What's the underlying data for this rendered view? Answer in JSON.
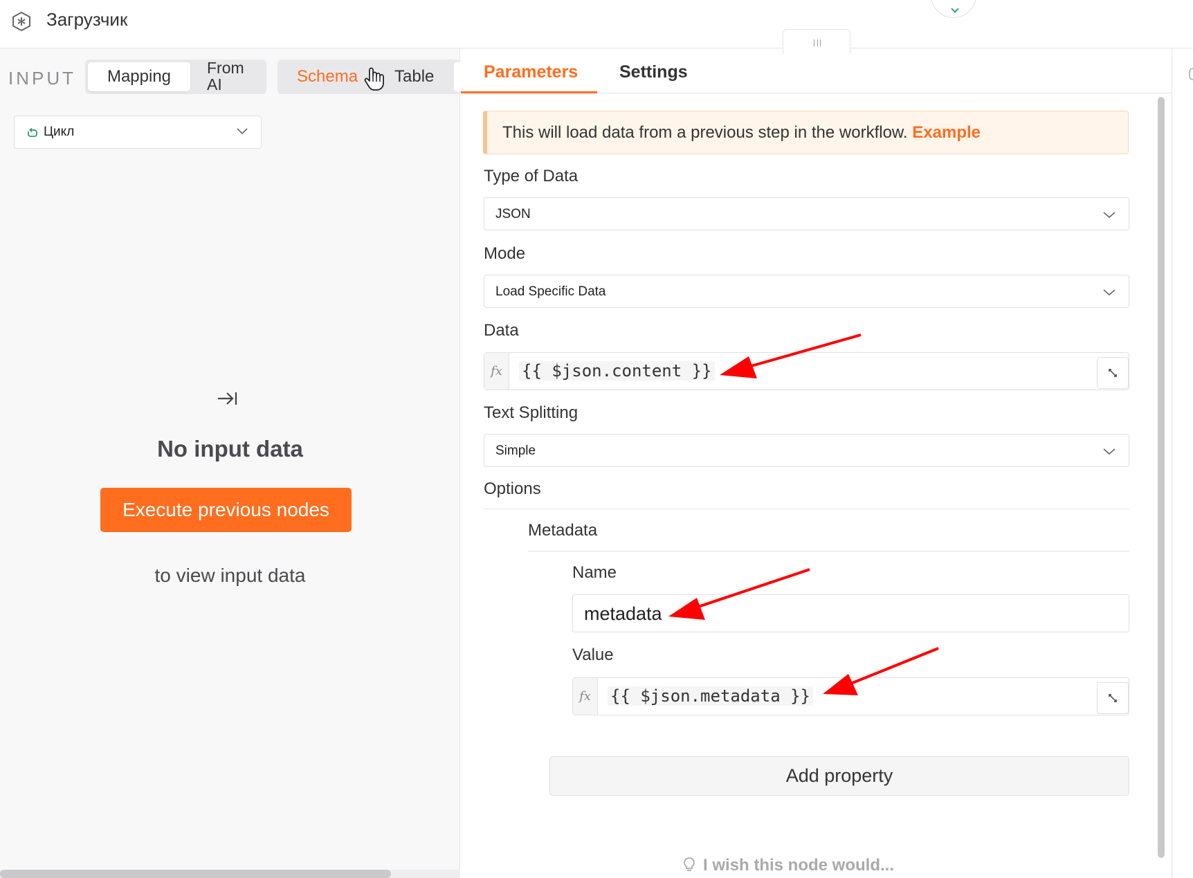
{
  "header": {
    "node_icon": "node-hexagon-icon",
    "title": "Загрузчик"
  },
  "input_panel": {
    "label": "INPUT",
    "mode_options": [
      "Mapping",
      "From AI"
    ],
    "mode_selected": "Mapping",
    "view_options": [
      "Schema",
      "Table"
    ],
    "view_selected": "Schema",
    "run_selector": {
      "icon": "loop-icon",
      "label": "Цикл"
    },
    "empty_state": {
      "icon": "arrow-to-right-icon",
      "title": "No input data",
      "button": "Execute previous nodes",
      "subtitle": "to view input data"
    }
  },
  "params_panel": {
    "tabs": [
      "Parameters",
      "Settings"
    ],
    "active_tab": "Parameters",
    "notice": {
      "text": "This will load data from a previous step in the workflow.",
      "link": "Example"
    },
    "type_of_data": {
      "label": "Type of Data",
      "value": "JSON"
    },
    "mode": {
      "label": "Mode",
      "value": "Load Specific Data"
    },
    "data": {
      "label": "Data",
      "fx": "fx",
      "value": "{{ $json.content }}"
    },
    "text_splitting": {
      "label": "Text Splitting",
      "value": "Simple"
    },
    "options": {
      "label": "Options",
      "metadata": {
        "label": "Metadata",
        "name": {
          "label": "Name",
          "value": "metadata"
        },
        "value": {
          "label": "Value",
          "fx": "fx",
          "value": "{{ $json.metadata }}"
        }
      }
    },
    "add_property": "Add property",
    "feedback": "I wish this node would..."
  },
  "colors": {
    "accent": "#ff6d1f",
    "annotation_arrow": "#ff0000",
    "notice_bg": "#fff5eb"
  }
}
